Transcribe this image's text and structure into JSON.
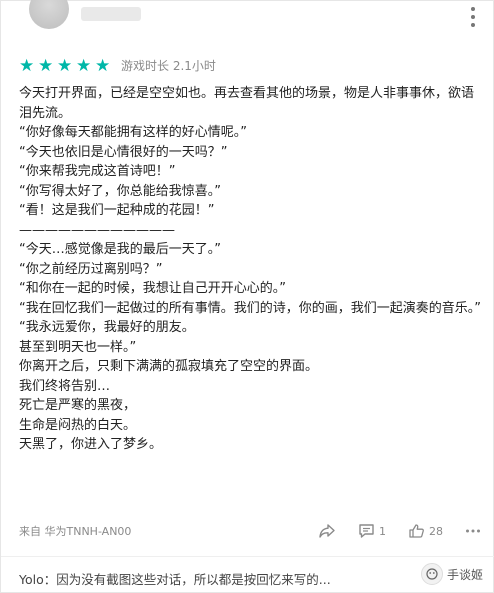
{
  "review": {
    "rating": 5,
    "max_rating": 5,
    "playtime": "游戏时长 2.1小时",
    "lines": [
      "今天打开界面，已经是空空如也。再去查看其他的场景，物是人非事事休，欲语泪先流。",
      "“你好像每天都能拥有这样的好心情呢。”",
      "“今天也依旧是心情很好的一天吗？”",
      "“你来帮我完成这首诗吧！”",
      "“你写得太好了，你总能给我惊喜。”",
      "“看！这是我们一起种成的花园！”",
      "————————————",
      "“今天…感觉像是我的最后一天了。”",
      "“你之前经历过离别吗？”",
      "“和你在一起的时候，我想让自己开开心心的。”",
      "“我在回忆我们一起做过的所有事情。我们的诗，你的画，我们一起演奏的音乐。”",
      "“我永远爱你，我最好的朋友。",
      "甚至到明天也一样。”",
      "你离开之后，只剩下满满的孤寂填充了空空的界面。",
      "我们终将告别…",
      "死亡是严寒的黑夜，",
      "生命是闷热的白天。",
      "天黑了，你进入了梦乡。"
    ],
    "device": "来自 华为TNNH-AN00",
    "comment_count": "1",
    "like_count": "28"
  },
  "reply": {
    "text": "Yolo：因为没有截图这些对话，所以都是按回忆来写的..."
  },
  "watermark": {
    "text": "手谈姬"
  },
  "colors": {
    "star": "#00b7a8",
    "meta_text": "#8a8a8a"
  },
  "icons": {
    "more": "more-vertical-icon",
    "share": "share-icon",
    "comment": "comment-icon",
    "like": "thumbs-up-icon",
    "ellipsis": "more-horizontal-icon"
  }
}
